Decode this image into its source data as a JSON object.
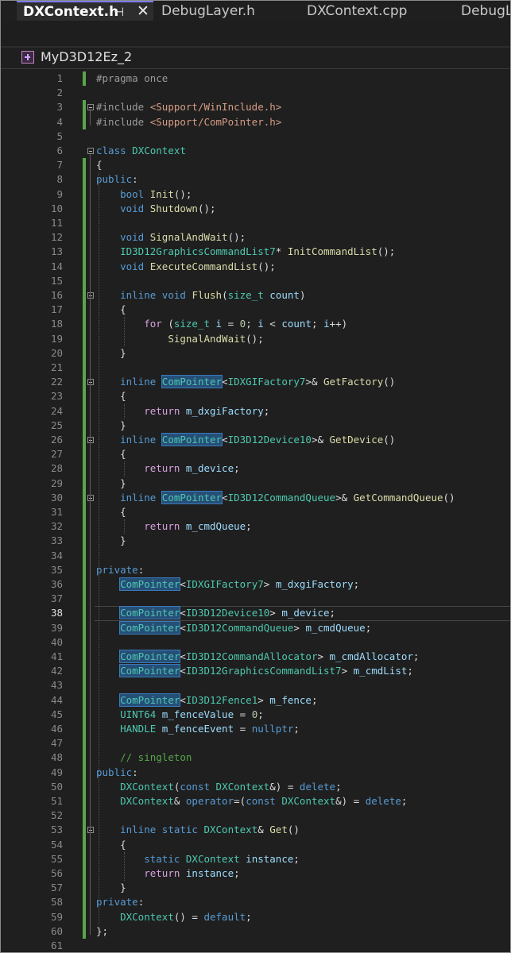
{
  "tabs": [
    {
      "label": "DXContext.h",
      "active": true,
      "pin_icon": "pin-icon",
      "close_icon": "close-icon"
    },
    {
      "label": "DebugLayer.h",
      "active": false
    },
    {
      "label": "DXContext.cpp",
      "active": false
    },
    {
      "label": "DebugL",
      "active": false
    }
  ],
  "project": {
    "name": "MyD3D12Ez_2",
    "icon": "cpp-project-icon"
  },
  "editor": {
    "current_line": 38,
    "lines": [
      {
        "n": "1",
        "text": "#pragma once"
      },
      {
        "n": "2",
        "text": ""
      },
      {
        "n": "3",
        "text": "#include <Support/WinInclude.h>"
      },
      {
        "n": "4",
        "text": "#include <Support/ComPointer.h>"
      },
      {
        "n": "5",
        "text": ""
      },
      {
        "n": "6",
        "text": "class DXContext"
      },
      {
        "n": "7",
        "text": "{"
      },
      {
        "n": "8",
        "text": "public:"
      },
      {
        "n": "9",
        "text": "    bool Init();"
      },
      {
        "n": "10",
        "text": "    void Shutdown();"
      },
      {
        "n": "11",
        "text": ""
      },
      {
        "n": "12",
        "text": "    void SignalAndWait();"
      },
      {
        "n": "13",
        "text": "    ID3D12GraphicsCommandList7* InitCommandList();"
      },
      {
        "n": "14",
        "text": "    void ExecuteCommandList();"
      },
      {
        "n": "15",
        "text": ""
      },
      {
        "n": "16",
        "text": "    inline void Flush(size_t count)"
      },
      {
        "n": "17",
        "text": "    {"
      },
      {
        "n": "18",
        "text": "        for (size_t i = 0; i < count; i++)"
      },
      {
        "n": "19",
        "text": "            SignalAndWait();"
      },
      {
        "n": "20",
        "text": "    }"
      },
      {
        "n": "21",
        "text": ""
      },
      {
        "n": "22",
        "text": "    inline ComPointer<IDXGIFactory7>& GetFactory()"
      },
      {
        "n": "23",
        "text": "    {"
      },
      {
        "n": "24",
        "text": "        return m_dxgiFactory;"
      },
      {
        "n": "25",
        "text": "    }"
      },
      {
        "n": "26",
        "text": "    inline ComPointer<ID3D12Device10>& GetDevice()"
      },
      {
        "n": "27",
        "text": "    {"
      },
      {
        "n": "28",
        "text": "        return m_device;"
      },
      {
        "n": "29",
        "text": "    }"
      },
      {
        "n": "30",
        "text": "    inline ComPointer<ID3D12CommandQueue>& GetCommandQueue()"
      },
      {
        "n": "31",
        "text": "    {"
      },
      {
        "n": "32",
        "text": "        return m_cmdQueue;"
      },
      {
        "n": "33",
        "text": "    }"
      },
      {
        "n": "34",
        "text": ""
      },
      {
        "n": "35",
        "text": "private:"
      },
      {
        "n": "36",
        "text": "    ComPointer<IDXGIFactory7> m_dxgiFactory;"
      },
      {
        "n": "37",
        "text": ""
      },
      {
        "n": "38",
        "text": "    ComPointer<ID3D12Device10> m_device;"
      },
      {
        "n": "39",
        "text": "    ComPointer<ID3D12CommandQueue> m_cmdQueue;"
      },
      {
        "n": "40",
        "text": ""
      },
      {
        "n": "41",
        "text": "    ComPointer<ID3D12CommandAllocator> m_cmdAllocator;"
      },
      {
        "n": "42",
        "text": "    ComPointer<ID3D12GraphicsCommandList7> m_cmdList;"
      },
      {
        "n": "43",
        "text": ""
      },
      {
        "n": "44",
        "text": "    ComPointer<ID3D12Fence1> m_fence;"
      },
      {
        "n": "45",
        "text": "    UINT64 m_fenceValue = 0;"
      },
      {
        "n": "46",
        "text": "    HANDLE m_fenceEvent = nullptr;"
      },
      {
        "n": "47",
        "text": ""
      },
      {
        "n": "48",
        "text": "    // singleton"
      },
      {
        "n": "49",
        "text": "public:"
      },
      {
        "n": "50",
        "text": "    DXContext(const DXContext&) = delete;"
      },
      {
        "n": "51",
        "text": "    DXContext& operator=(const DXContext&) = delete;"
      },
      {
        "n": "52",
        "text": ""
      },
      {
        "n": "53",
        "text": "    inline static DXContext& Get()"
      },
      {
        "n": "54",
        "text": "    {"
      },
      {
        "n": "55",
        "text": "        static DXContext instance;"
      },
      {
        "n": "56",
        "text": "        return instance;"
      },
      {
        "n": "57",
        "text": "    }"
      },
      {
        "n": "58",
        "text": "private:"
      },
      {
        "n": "59",
        "text": "    DXContext() = default;"
      },
      {
        "n": "60",
        "text": "};"
      },
      {
        "n": "61",
        "text": ""
      }
    ]
  },
  "colors": {
    "keyword": "#569cd6",
    "type": "#4ec9b0",
    "function": "#dcdcaa",
    "include_path": "#d69d85",
    "comment": "#57a64a",
    "change_bar": "#57a64a",
    "tab_accent": "#7a7df0"
  }
}
